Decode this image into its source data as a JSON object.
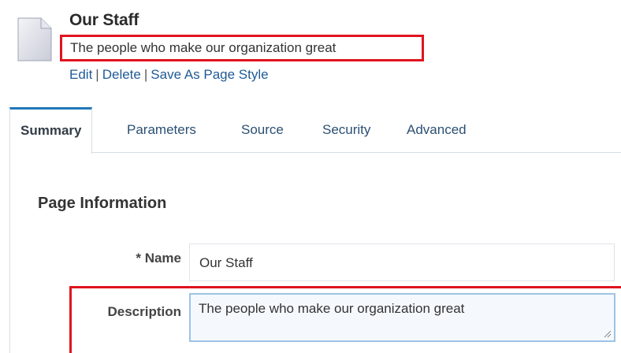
{
  "header": {
    "title": "Our Staff",
    "description": "The people who make our organization great",
    "actions": {
      "edit": "Edit",
      "delete": "Delete",
      "save_as_style": "Save As Page Style",
      "separator": "|"
    }
  },
  "tabs": [
    {
      "label": "Summary",
      "active": true
    },
    {
      "label": "Parameters",
      "active": false
    },
    {
      "label": "Source",
      "active": false
    },
    {
      "label": "Security",
      "active": false
    },
    {
      "label": "Advanced",
      "active": false
    }
  ],
  "section": {
    "title": "Page Information",
    "required_marker": "*",
    "name_label": "Name",
    "name_value": "Our Staff",
    "description_label": "Description",
    "description_value": "The people who make our organization great"
  },
  "colors": {
    "highlight": "#e0141e",
    "link": "#1f5a96",
    "tab_accent": "#2277b8"
  },
  "icons": {
    "page": "page-document-icon",
    "resize": "resize-grip-icon"
  }
}
